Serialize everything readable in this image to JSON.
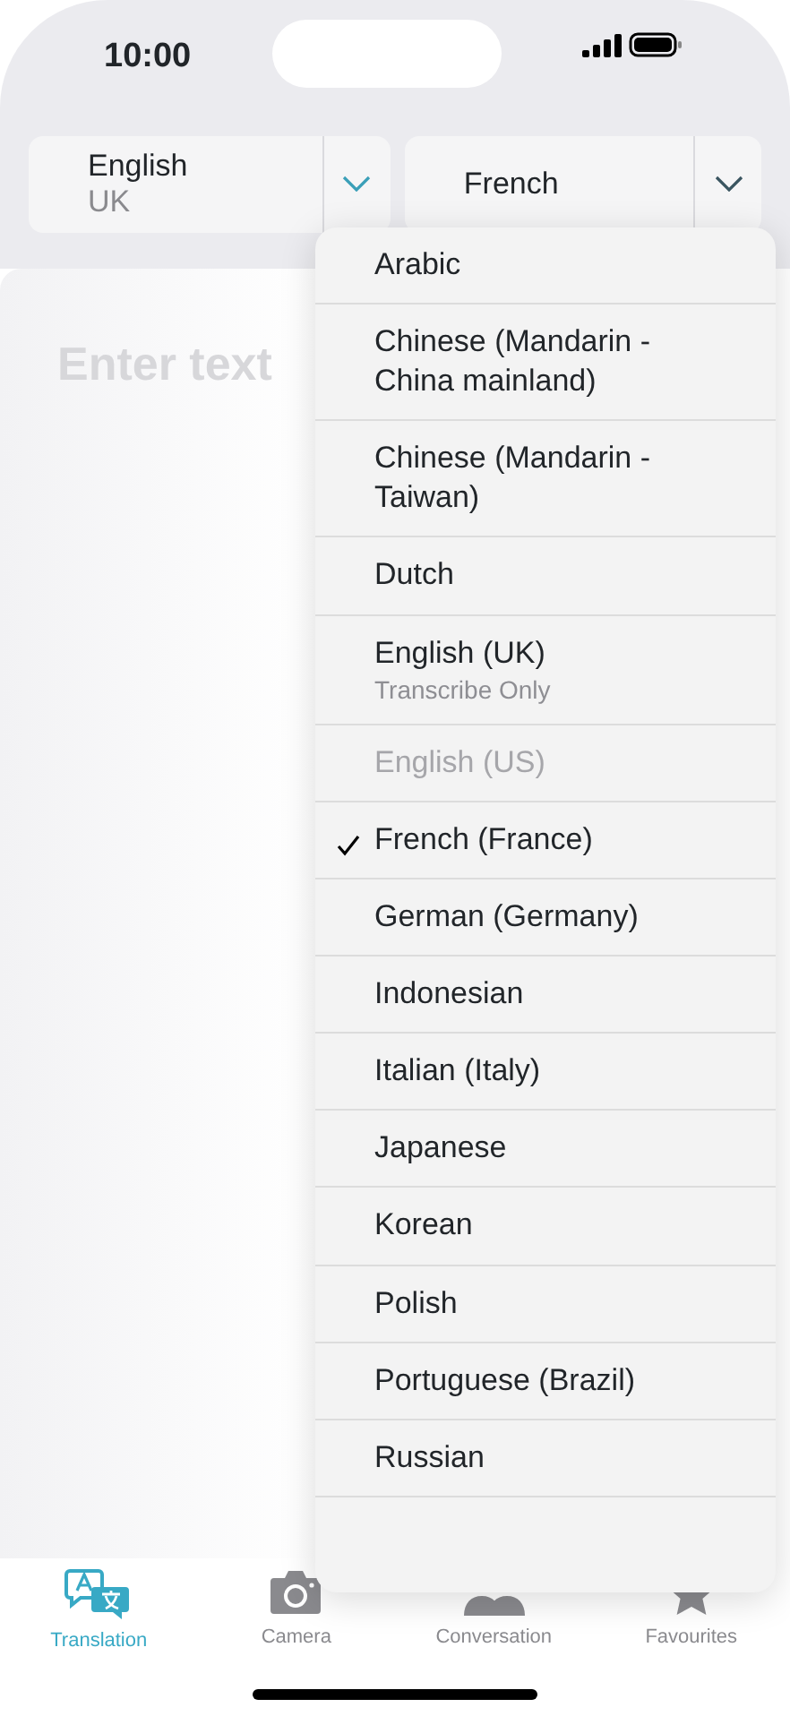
{
  "status_bar": {
    "time": "10:00"
  },
  "source_language": {
    "name": "English",
    "region": "UK"
  },
  "target_language": {
    "name": "French"
  },
  "input": {
    "placeholder": "Enter text"
  },
  "language_menu": [
    {
      "label": "Arabic",
      "selected": false,
      "disabled": false
    },
    {
      "label": "Chinese (Mandarin - China mainland)",
      "selected": false,
      "disabled": false
    },
    {
      "label": "Chinese (Mandarin - Taiwan)",
      "selected": false,
      "disabled": false
    },
    {
      "label": "Dutch",
      "selected": false,
      "disabled": false
    },
    {
      "label": "English (UK)",
      "note": "Transcribe Only",
      "selected": false,
      "disabled": false
    },
    {
      "label": "English (US)",
      "selected": false,
      "disabled": true
    },
    {
      "label": "French (France)",
      "selected": true,
      "disabled": false
    },
    {
      "label": "German (Germany)",
      "selected": false,
      "disabled": false
    },
    {
      "label": "Indonesian",
      "selected": false,
      "disabled": false
    },
    {
      "label": "Italian (Italy)",
      "selected": false,
      "disabled": false
    },
    {
      "label": "Japanese",
      "selected": false,
      "disabled": false
    },
    {
      "label": "Korean",
      "selected": false,
      "disabled": false
    },
    {
      "label": "Polish",
      "selected": false,
      "disabled": false
    },
    {
      "label": "Portuguese (Brazil)",
      "selected": false,
      "disabled": false
    },
    {
      "label": "Russian",
      "selected": false,
      "disabled": false
    }
  ],
  "tab_bar": [
    {
      "label": "Translation",
      "kind": "translate",
      "selected": true
    },
    {
      "label": "Camera",
      "kind": "camera",
      "selected": false
    },
    {
      "label": "Conversation",
      "kind": "people",
      "selected": false
    },
    {
      "label": "Favourites",
      "kind": "star",
      "selected": false
    }
  ]
}
